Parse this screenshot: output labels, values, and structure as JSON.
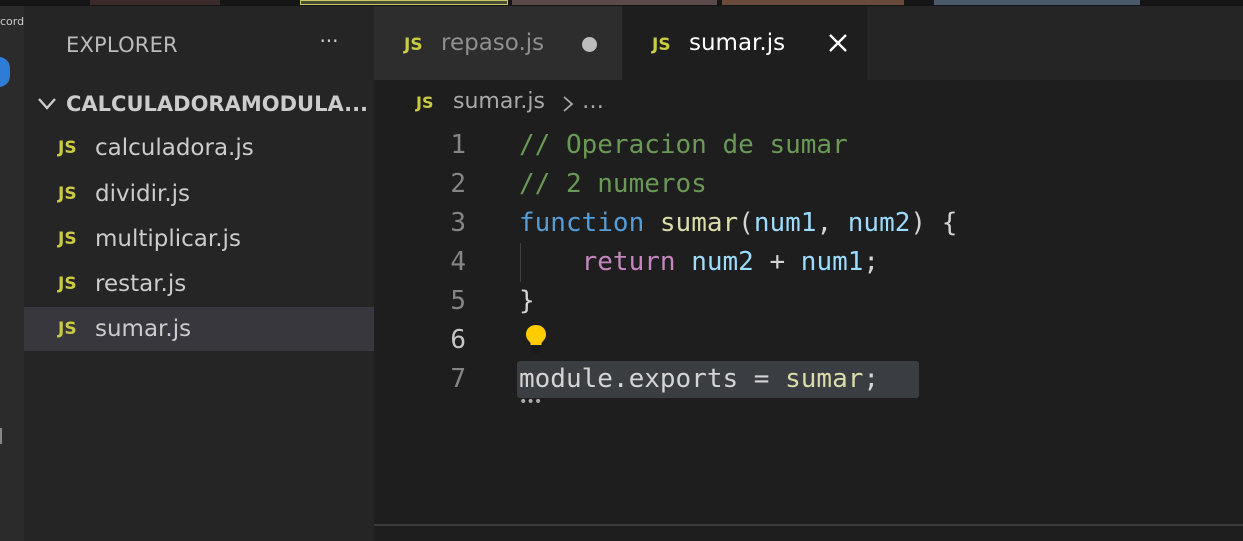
{
  "recording_label": "cording",
  "sidebar": {
    "title": "EXPLORER",
    "more_label": "···",
    "folder_name": "CALCULADORAMODULA...",
    "files": [
      {
        "badge": "JS",
        "name": "calculadora.js"
      },
      {
        "badge": "JS",
        "name": "dividir.js"
      },
      {
        "badge": "JS",
        "name": "multiplicar.js"
      },
      {
        "badge": "JS",
        "name": "restar.js"
      },
      {
        "badge": "JS",
        "name": "sumar.js"
      }
    ],
    "selected_file": "sumar.js"
  },
  "tabs": [
    {
      "badge": "JS",
      "label": "repaso.js",
      "state": "unsaved"
    },
    {
      "badge": "JS",
      "label": "sumar.js",
      "state": "active"
    }
  ],
  "breadcrumb": {
    "badge": "JS",
    "file": "sumar.js",
    "more": "…"
  },
  "editor": {
    "active_line": 6,
    "lines": [
      {
        "num": "1",
        "tokens": [
          {
            "t": "// Operacion de sumar",
            "k": "comment"
          }
        ]
      },
      {
        "num": "2",
        "tokens": [
          {
            "t": "// 2 numeros",
            "k": "comment"
          }
        ]
      },
      {
        "num": "3",
        "tokens": [
          {
            "t": "function",
            "k": "keyword"
          },
          {
            "t": " ",
            "k": "punct"
          },
          {
            "t": "sumar",
            "k": "func"
          },
          {
            "t": "(",
            "k": "punct"
          },
          {
            "t": "num1",
            "k": "var"
          },
          {
            "t": ", ",
            "k": "punct"
          },
          {
            "t": "num2",
            "k": "var"
          },
          {
            "t": ") {",
            "k": "punct"
          }
        ]
      },
      {
        "num": "4",
        "tokens": [
          {
            "t": "    ",
            "k": "punct"
          },
          {
            "t": "return",
            "k": "control"
          },
          {
            "t": " ",
            "k": "punct"
          },
          {
            "t": "num2",
            "k": "var"
          },
          {
            "t": " + ",
            "k": "punct"
          },
          {
            "t": "num1",
            "k": "var"
          },
          {
            "t": ";",
            "k": "punct"
          }
        ]
      },
      {
        "num": "5",
        "tokens": [
          {
            "t": "}",
            "k": "punct"
          }
        ]
      },
      {
        "num": "6",
        "tokens": []
      },
      {
        "num": "7",
        "tokens": [
          {
            "t": "module",
            "k": "punct"
          },
          {
            "t": ".",
            "k": "punct"
          },
          {
            "t": "exports",
            "k": "punct"
          },
          {
            "t": " = ",
            "k": "punct"
          },
          {
            "t": "sumar",
            "k": "func"
          },
          {
            "t": ";",
            "k": "punct"
          }
        ]
      }
    ],
    "dotted_hint": "•••"
  },
  "icons": {
    "folder_chevron": "chevron-down-icon",
    "tab_close": "close-icon",
    "breadcrumb_separator": "chevron-right-icon",
    "code_action": "lightbulb-icon"
  },
  "colors": {
    "js_badge": "#cbcb41",
    "comment": "#6a9955",
    "keyword": "#569cd6",
    "function": "#dcdcaa",
    "variable": "#9cdcfe",
    "control": "#c586c0",
    "lightbulb": "#ffcc00"
  }
}
